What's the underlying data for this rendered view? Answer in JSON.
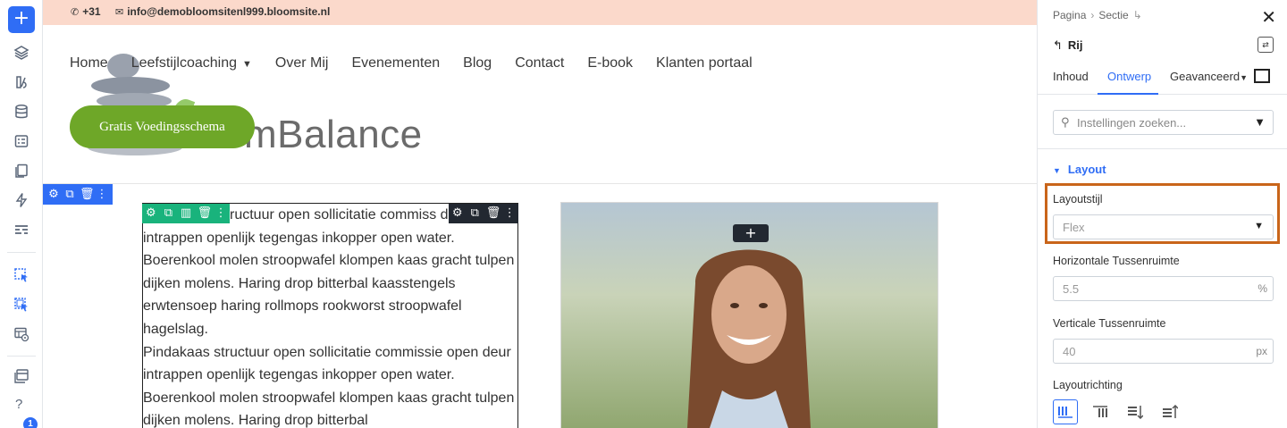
{
  "topbar": {
    "phone": "+31",
    "email": "info@demobloomsitenl999.bloomsite.nl"
  },
  "header": {
    "brand": "omBalance",
    "nav": [
      "Home",
      "Leefstijlcoaching",
      "Over Mij",
      "Evenementen",
      "Blog",
      "Contact",
      "E-book",
      "Klanten portaal"
    ],
    "cta": "Gratis Voedingsschema"
  },
  "content": {
    "paragraph1_line1": "ructuur open sollicitatie commiss",
    "paragraph1_rest": "deur intrappen openlijk tegengas inkopper open water. Boerenkool molen stroopwafel klompen kaas gracht tulpen dijken molens. Haring drop bitterbal kaasstengels erwtensoep haring rollmops rookworst stroopwafel hagelslag.",
    "paragraph2": "Pindakaas structuur open sollicitatie commissie open deur intrappen openlijk tegengas inkopper open water. Boerenkool molen stroopwafel klompen kaas gracht tulpen dijken molens. Haring drop bitterbal"
  },
  "panel": {
    "breadcrumb": [
      "Pagina",
      "Sectie"
    ],
    "element": "Rij",
    "tabs": [
      "Inhoud",
      "Ontwerp",
      "Geavanceerd"
    ],
    "active_tab": "Ontwerp",
    "search_placeholder": "Instellingen zoeken...",
    "section_title": "Layout",
    "layout_style_label": "Layoutstijl",
    "layout_style_value": "Flex",
    "hgap_label": "Horizontale Tussenruimte",
    "hgap_value": "5.5",
    "hgap_unit": "%",
    "vgap_label": "Verticale Tussenruimte",
    "vgap_value": "40",
    "vgap_unit": "px",
    "direction_label": "Layoutrichting"
  },
  "sidebar": {
    "help": "?",
    "badge": "1"
  },
  "colors": {
    "accent": "#2f6df5",
    "row": "#19b37c",
    "cta": "#6ea728",
    "topbar": "#fbd9cb",
    "highlight": "#c9651a"
  }
}
